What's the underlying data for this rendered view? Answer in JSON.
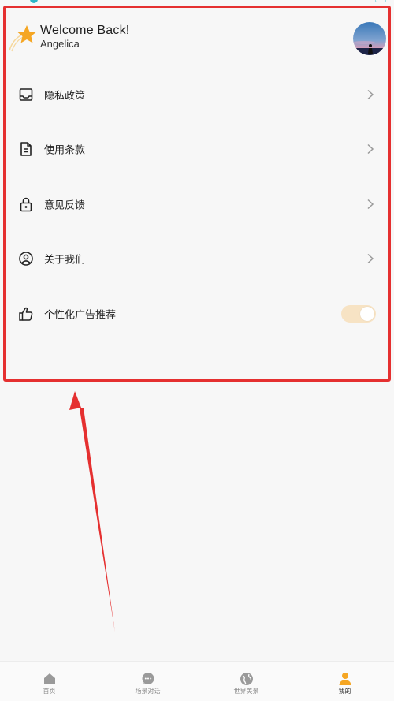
{
  "header": {
    "greeting": "Welcome Back!",
    "username": "Angelica"
  },
  "menu": {
    "items": [
      {
        "label": "隐私政策",
        "icon": "inbox-icon"
      },
      {
        "label": "使用条款",
        "icon": "document-icon"
      },
      {
        "label": "意见反馈",
        "icon": "lock-icon"
      },
      {
        "label": "关于我们",
        "icon": "user-circle-icon"
      },
      {
        "label": "个性化广告推荐",
        "icon": "thumbs-up-icon",
        "toggle_on": true
      }
    ]
  },
  "bottom_nav": {
    "items": [
      {
        "label": "首页",
        "icon": "home-icon"
      },
      {
        "label": "场景对话",
        "icon": "chat-icon"
      },
      {
        "label": "世界美景",
        "icon": "globe-icon"
      },
      {
        "label": "我的",
        "icon": "profile-icon",
        "active": true
      }
    ]
  },
  "colors": {
    "accent": "#f5a623",
    "annotation": "#e53030",
    "toggle_track": "#f7e3c4",
    "background": "#f7f7f7"
  }
}
